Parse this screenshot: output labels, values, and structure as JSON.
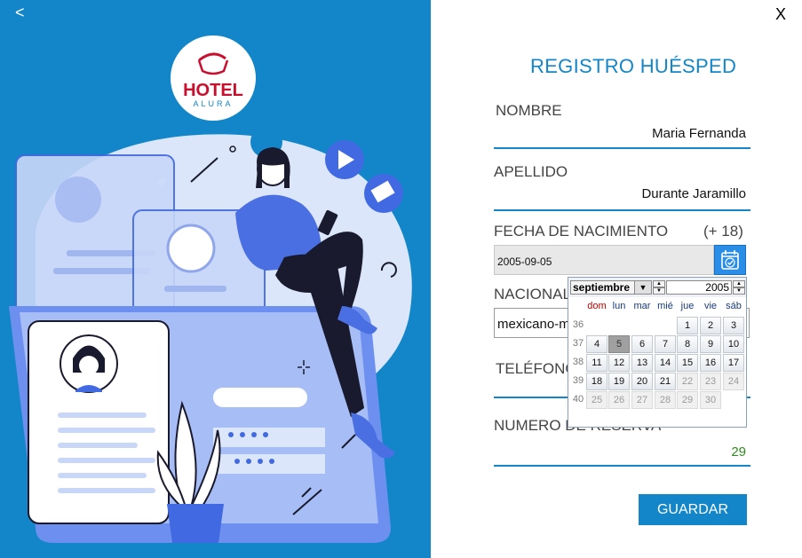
{
  "nav": {
    "back": "<",
    "close": "X"
  },
  "logo": {
    "line1": "HOTEL",
    "line2": "ALURA"
  },
  "form": {
    "title": "REGISTRO HUÉSPED",
    "nombre_label": "NOMBRE",
    "nombre_value": "Maria Fernanda",
    "apellido_label": "APELLIDO",
    "apellido_value": "Durante Jaramillo",
    "fecha_label": "FECHA DE NACIMIENTO",
    "fecha_note": "(+ 18)",
    "fecha_value": "2005-09-05",
    "nacionalidad_label": "NACIONALIDAD",
    "nacionalidad_value": "mexicano-mexicana",
    "telefono_label": "TELÉFONO",
    "reserva_label": "NUMERO DE RESERVA",
    "reserva_value": "29",
    "guardar_label": "GUARDAR"
  },
  "calendar": {
    "month": "septiembre",
    "year": "2005",
    "weekdays": [
      "dom",
      "lun",
      "mar",
      "mié",
      "jue",
      "vie",
      "sáb"
    ],
    "weeks": [
      "36",
      "37",
      "38",
      "39",
      "40"
    ],
    "days": [
      [
        "",
        "",
        "",
        "",
        "1",
        "2",
        "3"
      ],
      [
        "4",
        "5",
        "6",
        "7",
        "8",
        "9",
        "10"
      ],
      [
        "11",
        "12",
        "13",
        "14",
        "15",
        "16",
        "17"
      ],
      [
        "18",
        "19",
        "20",
        "21",
        "22",
        "23",
        "24"
      ],
      [
        "25",
        "26",
        "27",
        "28",
        "29",
        "30",
        ""
      ]
    ],
    "selected_day": "5",
    "colors": {
      "sunday": "#c00000",
      "weekday": "#1a3a78"
    }
  },
  "colors": {
    "accent": "#1286c8",
    "reserva": "#2e8b1e"
  }
}
